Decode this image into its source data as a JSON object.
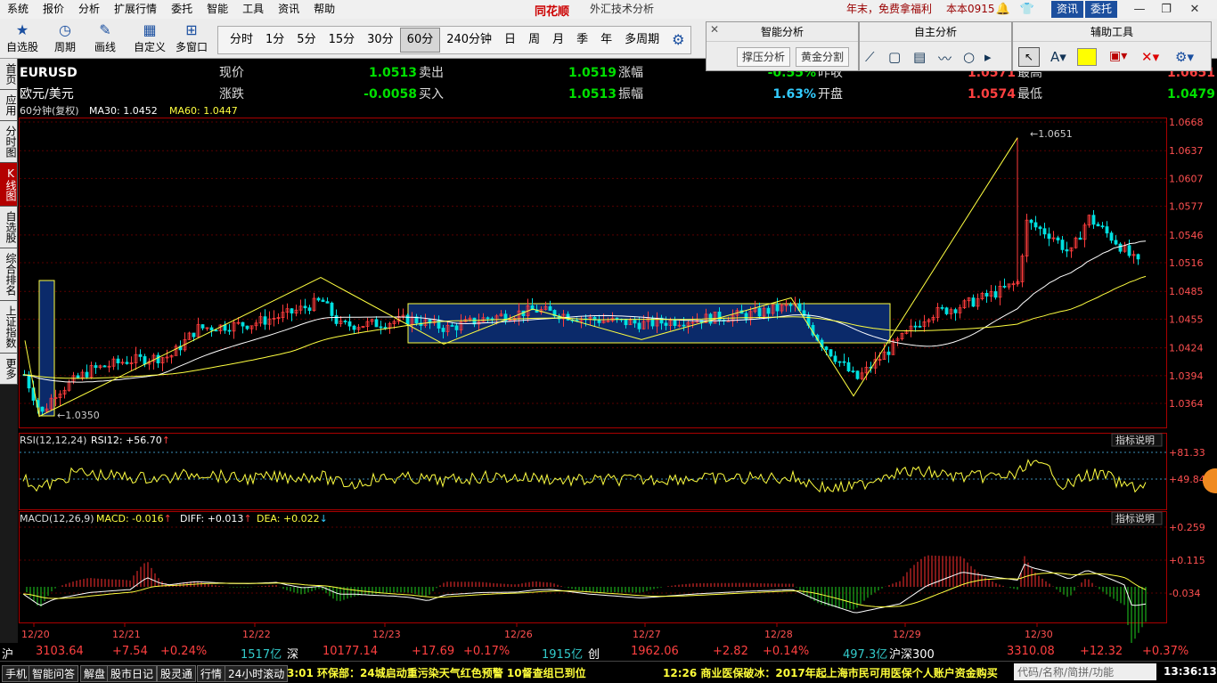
{
  "menu": {
    "items": [
      "系统",
      "报价",
      "分析",
      "扩展行情",
      "委托",
      "智能",
      "工具",
      "资讯",
      "帮助"
    ],
    "logo": "同花顺",
    "title": "外汇技术分析",
    "promo": "年末，免费拿福利",
    "version": "本本0915",
    "btn_news": "资讯",
    "btn_trade": "委托"
  },
  "toolbar": {
    "buttons": [
      {
        "label": "自选股",
        "icon": "star-icon"
      },
      {
        "label": "周期",
        "icon": "clock-icon"
      },
      {
        "label": "画线",
        "icon": "pencil-icon"
      },
      {
        "label": "自定义",
        "icon": "grid-icon"
      },
      {
        "label": "多窗口",
        "icon": "window-icon"
      }
    ],
    "periods": [
      "分时",
      "1分",
      "5分",
      "15分",
      "30分",
      "60分",
      "240分钟",
      "日",
      "周",
      "月",
      "季",
      "年",
      "多周期"
    ],
    "active_period": "60分"
  },
  "panels": {
    "smart": {
      "title": "智能分析",
      "btn1": "撑压分析",
      "btn2": "黄金分割"
    },
    "self": {
      "title": "自主分析"
    },
    "aux": {
      "title": "辅助工具"
    }
  },
  "sidetabs": [
    "首页",
    "应用",
    "分时图",
    "K线图",
    "自选股",
    "综合排名",
    "上证指数",
    "更多"
  ],
  "quote": {
    "code": "EURUSD",
    "name": "欧元/美元",
    "price_label": "现价",
    "price": "1.0513",
    "sell_label": "卖出",
    "sell": "1.0519",
    "chgpct_label": "涨幅",
    "chgpct": "-0.55%",
    "prev_label": "昨收",
    "prev": "1.0571",
    "high_label": "最高",
    "high": "1.0651",
    "chg_label": "涨跌",
    "chg": "-0.0058",
    "buy_label": "买入",
    "buy": "1.0513",
    "amp_label": "振幅",
    "amp": "1.63%",
    "open_label": "开盘",
    "open": "1.0574",
    "low_label": "最低",
    "low": "1.0479"
  },
  "main_chart": {
    "period_label": "60分钟(复权)",
    "ma30": "MA30: 1.0452",
    "ma60": "MA60: 1.0447",
    "y_ticks": [
      "1.0668",
      "1.0637",
      "1.0607",
      "1.0577",
      "1.0546",
      "1.0516",
      "1.0485",
      "1.0455",
      "1.0424",
      "1.0394",
      "1.0364"
    ],
    "hi_label": "1.0651",
    "lo_label": "1.0350",
    "x_labels": [
      "12/20",
      "12/21",
      "12/22",
      "12/23",
      "12/26",
      "12/27",
      "12/28",
      "12/29",
      "12/30"
    ]
  },
  "rsi": {
    "title": "RSI(12,12,24)",
    "value": "RSI12: +56.70",
    "help": "指标说明",
    "ticks": [
      "+81.33",
      "+49.84"
    ]
  },
  "macd": {
    "title": "MACD(12,26,9)",
    "macd": "MACD: -0.016",
    "diff": "DIFF: +0.013",
    "dea": "DEA: +0.022",
    "help": "指标说明",
    "ticks": [
      "+0.259",
      "+0.115",
      "-0.034"
    ]
  },
  "status": {
    "sh_label": "沪",
    "sh": "3103.64",
    "sh_chg": "+7.54",
    "sh_pct": "+0.24%",
    "sh_vol": "1517亿",
    "sz_label": "深",
    "sz": "10177.14",
    "sz_chg": "+17.69",
    "sz_pct": "+0.17%",
    "sz_vol": "1915亿",
    "cy_label": "创",
    "cy": "1962.06",
    "cy_chg": "+2.82",
    "cy_pct": "+0.14%",
    "cy_vol": "497.3亿",
    "hs_label": "沪深300",
    "hs": "3310.08",
    "hs_chg": "+12.32",
    "hs_pct": "+0.37%"
  },
  "ticker": {
    "tabs": [
      "手机",
      "智能问答",
      "解盘",
      "股市日记",
      "股灵通",
      "行情",
      "24小时滚动"
    ],
    "news1": "3:01 环保部：24城启动重污染天气红色预警 10督查组已到位",
    "news2": "12:26 商业医保破冰：2017年起上海市民可用医保个人账户资金购买",
    "search": "代码/名称/简拼/功能",
    "time": "13:36:13"
  },
  "colors": {
    "up": "#ff3c3c",
    "down": "#00e0e0",
    "ma30": "#ffffff",
    "ma60": "#ffff40",
    "grid": "#6e0000",
    "box": "#0b2a6a"
  }
}
